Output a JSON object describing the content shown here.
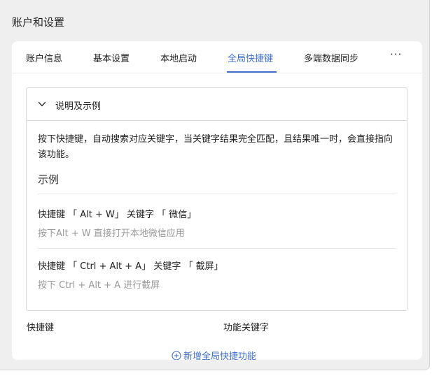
{
  "window": {
    "title": "账户和设置"
  },
  "tabs": [
    {
      "label": "账户信息"
    },
    {
      "label": "基本设置"
    },
    {
      "label": "本地启动"
    },
    {
      "label": "全局快捷键"
    },
    {
      "label": "多端数据同步"
    }
  ],
  "tabs_more": "···",
  "info": {
    "header": "说明及示例",
    "description": "按下快捷键，自动搜索对应关键字，当关键字结果完全匹配，且结果唯一时，会直接指向该功能。",
    "example_heading": "示例",
    "examples": [
      {
        "title": "快捷键 「 Alt + W」 关键字 「 微信」",
        "desc": "按下Alt + W 直接打开本地微信应用"
      },
      {
        "title": "快捷键 「 Ctrl + Alt + A」 关键字 「 截屏」",
        "desc": "按下 Ctrl + Alt + A 进行截屏"
      }
    ]
  },
  "columns": {
    "shortcut": "快捷键",
    "keyword": "功能关键字"
  },
  "add_button": "新增全局快捷功能",
  "colors": {
    "accent": "#3f6fc9",
    "muted_text": "#9a9a9a",
    "background": "#efefef"
  }
}
